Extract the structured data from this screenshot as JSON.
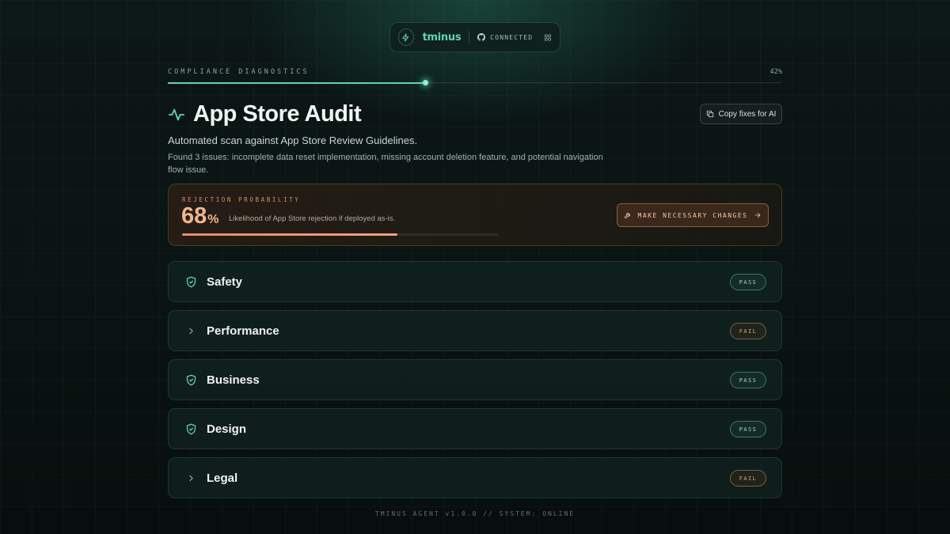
{
  "topbar": {
    "brand": "tminus",
    "connection_status": "CONNECTED",
    "icons": [
      "bolt-icon",
      "github-icon",
      "grid-icon"
    ]
  },
  "diagnostics": {
    "label": "COMPLIANCE DIAGNOSTICS",
    "progress_pct": 42,
    "progress_text": "42%"
  },
  "header": {
    "title": "App Store Audit",
    "subtitle": "Automated scan against App Store Review Guidelines.",
    "summary": "Found 3 issues: incomplete data reset implementation, missing account deletion feature, and potential navigation flow issue.",
    "copy_button": "Copy fixes for AI"
  },
  "risk": {
    "label": "REJECTION PROBABILITY",
    "value": "68",
    "unit": "%",
    "value_fraction": 0.68,
    "description": "Likelihood of App Store rejection if deployed as-is.",
    "action_button": "MAKE NECESSARY CHANGES"
  },
  "categories": [
    {
      "name": "Safety",
      "status": "PASS",
      "icon": "shield-check-icon"
    },
    {
      "name": "Performance",
      "status": "FAIL",
      "icon": "chevron-right-icon"
    },
    {
      "name": "Business",
      "status": "PASS",
      "icon": "shield-check-icon"
    },
    {
      "name": "Design",
      "status": "PASS",
      "icon": "shield-check-icon"
    },
    {
      "name": "Legal",
      "status": "FAIL",
      "icon": "chevron-right-icon"
    }
  ],
  "footer": "TMINUS AGENT v1.0.0 // SYSTEM: ONLINE",
  "colors": {
    "accent": "#5fd4b4",
    "warning": "#f2b48a",
    "fail": "#e0a47a"
  }
}
